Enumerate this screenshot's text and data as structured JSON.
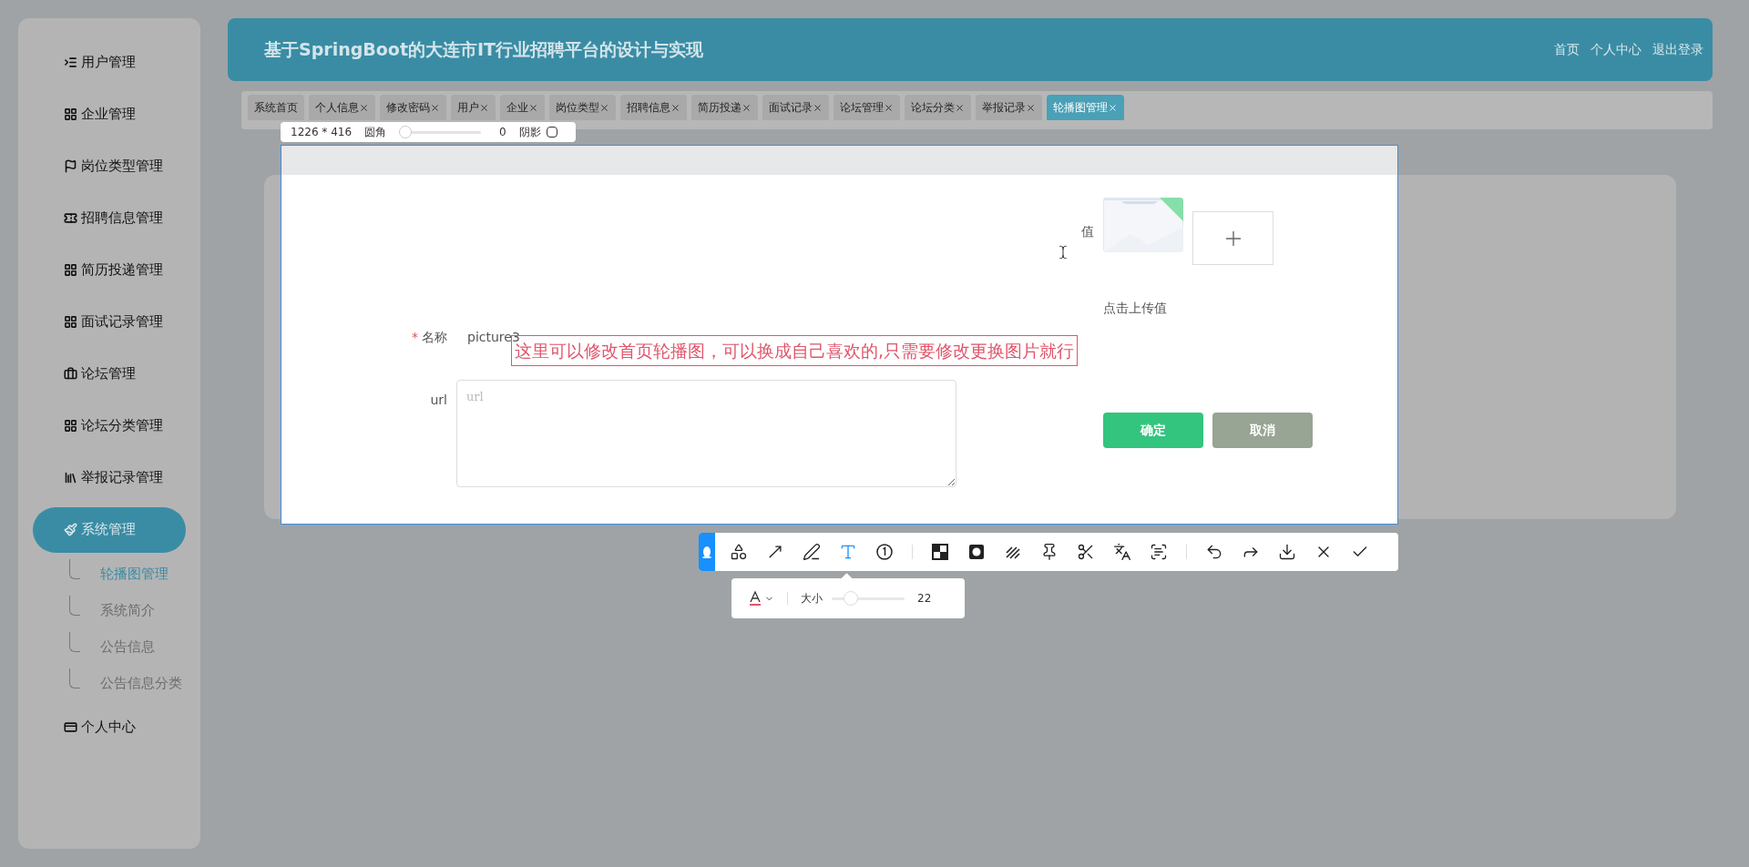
{
  "header": {
    "title": "基于SpringBoot的大连市IT行业招聘平台的设计与实现",
    "links": [
      "首页",
      "个人中心",
      "退出登录"
    ]
  },
  "sidebar": {
    "items": [
      {
        "label": "用户管理",
        "selected": false
      },
      {
        "label": "企业管理",
        "selected": false
      },
      {
        "label": "岗位类型管理",
        "selected": false
      },
      {
        "label": "招聘信息管理",
        "selected": false
      },
      {
        "label": "简历投递管理",
        "selected": false
      },
      {
        "label": "面试记录管理",
        "selected": false
      },
      {
        "label": "论坛管理",
        "selected": false
      },
      {
        "label": "论坛分类管理",
        "selected": false
      },
      {
        "label": "举报记录管理",
        "selected": false
      },
      {
        "label": "系统管理",
        "selected": true,
        "children": [
          {
            "label": "轮播图管理",
            "selected": true
          },
          {
            "label": "系统简介",
            "selected": false
          },
          {
            "label": "公告信息",
            "selected": false
          },
          {
            "label": "公告信息分类",
            "selected": false
          }
        ]
      },
      {
        "label": "个人中心",
        "selected": false
      }
    ]
  },
  "tabs": [
    {
      "label": "系统首页",
      "selected": false,
      "closable": false
    },
    {
      "label": "个人信息",
      "selected": false,
      "closable": true
    },
    {
      "label": "修改密码",
      "selected": false,
      "closable": true
    },
    {
      "label": "用户",
      "selected": false,
      "closable": true
    },
    {
      "label": "企业",
      "selected": false,
      "closable": true
    },
    {
      "label": "岗位类型",
      "selected": false,
      "closable": true
    },
    {
      "label": "招聘信息",
      "selected": false,
      "closable": true
    },
    {
      "label": "简历投递",
      "selected": false,
      "closable": true
    },
    {
      "label": "面试记录",
      "selected": false,
      "closable": true
    },
    {
      "label": "论坛管理",
      "selected": false,
      "closable": true
    },
    {
      "label": "论坛分类",
      "selected": false,
      "closable": true
    },
    {
      "label": "举报记录",
      "selected": false,
      "closable": true
    },
    {
      "label": "轮播图管理",
      "selected": true,
      "closable": true
    }
  ],
  "capture": {
    "size": "1226 * 416",
    "radius_label": "圆角",
    "radius": {
      "level": 0,
      "reading": "0"
    },
    "shadow_label": "阴影",
    "shadow_checked": false
  },
  "form": {
    "value_label": "值",
    "upload_hint": "点击上传值",
    "name": {
      "label": "名称",
      "required_mark": "*",
      "value": "picture3"
    },
    "url": {
      "label": "url",
      "placeholder": "url"
    },
    "buttons": [
      {
        "label": "确定",
        "kind": "primary"
      },
      {
        "label": "取消",
        "kind": "secondary"
      }
    ]
  },
  "annotation": "这里可以修改首页轮播图，可以换成自己喜欢的,只需要修改更换图片就行",
  "toolbar": {
    "tools": [
      {
        "selected": false
      },
      {
        "selected": false
      },
      {
        "selected": false
      },
      {
        "selected": true
      },
      {
        "selected": false
      },
      {
        "selected": false
      },
      {
        "selected": false
      },
      {
        "selected": false
      },
      {
        "selected": false
      },
      {
        "selected": false
      },
      {
        "selected": false
      },
      {
        "selected": false
      },
      {
        "selected": false
      },
      {
        "selected": false
      },
      {
        "selected": false
      },
      {
        "selected": false
      },
      {
        "selected": false
      }
    ],
    "text_options": {
      "size_label": "大小",
      "size": {
        "level": 0.2,
        "reading": "22"
      }
    }
  }
}
